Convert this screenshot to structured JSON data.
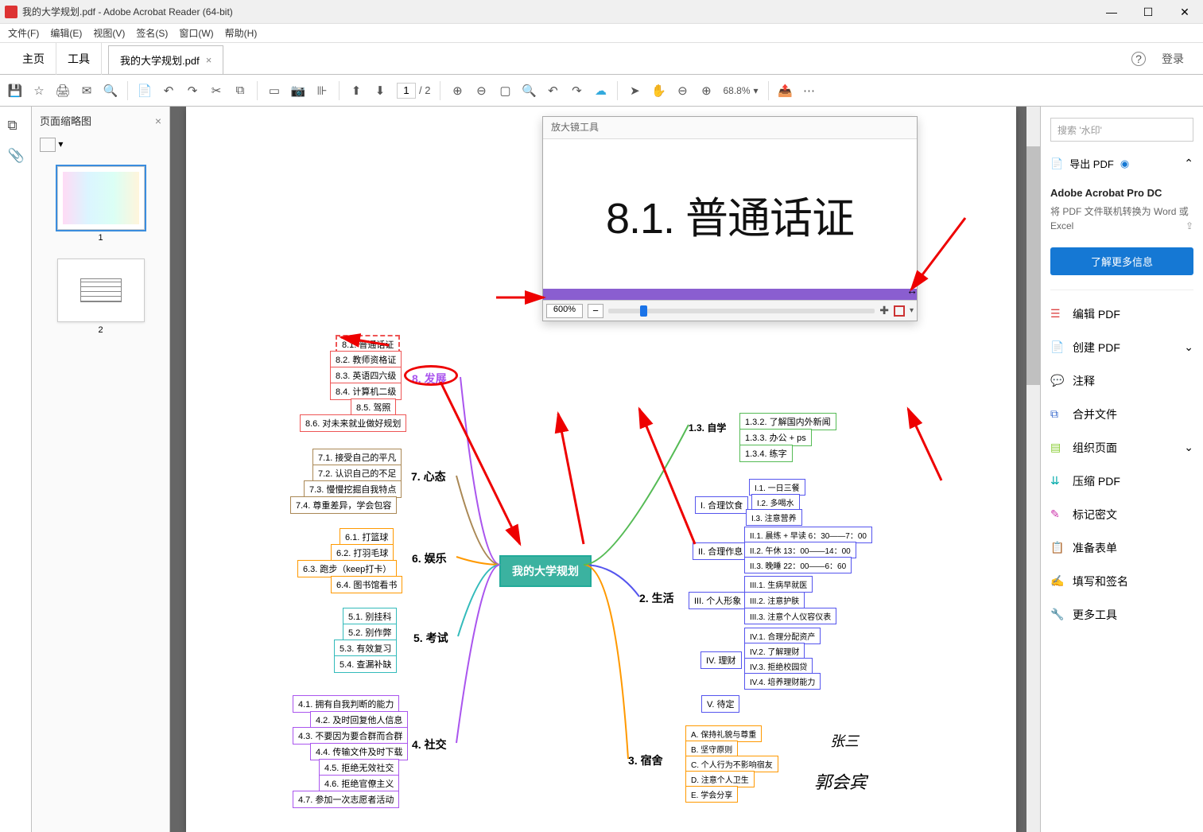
{
  "titlebar": {
    "title": "我的大学规划.pdf - Adobe Acrobat Reader (64-bit)"
  },
  "menu": [
    "文件(F)",
    "编辑(E)",
    "视图(V)",
    "签名(S)",
    "窗口(W)",
    "帮助(H)"
  ],
  "tabbar": {
    "home": "主页",
    "tools": "工具",
    "active": "我的大学规划.pdf",
    "login": "登录"
  },
  "toolbar": {
    "page_current": "1",
    "page_total": "/ 2",
    "zoom": "68.8%"
  },
  "thumbpane": {
    "title": "页面缩略图",
    "labels": [
      "1",
      "2"
    ]
  },
  "magnifier": {
    "title": "放大镜工具",
    "big_text": "8.1. 普通话证",
    "zoom": "600%"
  },
  "mindmap": {
    "center": "我的大学规划",
    "b8": {
      "label": "8. 发展",
      "items": [
        "8.1. 普通话证",
        "8.2. 教师资格证",
        "8.3. 英语四六级",
        "8.4. 计算机二级",
        "8.5. 驾照",
        "8.6. 对未来就业做好规划"
      ]
    },
    "b7": {
      "label": "7. 心态",
      "items": [
        "7.1. 接受自己的平凡",
        "7.2. 认识自己的不足",
        "7.3. 慢慢挖掘自我特点",
        "7.4. 尊重差异，学会包容"
      ]
    },
    "b6": {
      "label": "6. 娱乐",
      "items": [
        "6.1. 打篮球",
        "6.2. 打羽毛球",
        "6.3. 跑步（keep打卡）",
        "6.4. 图书馆看书"
      ]
    },
    "b5": {
      "label": "5. 考试",
      "items": [
        "5.1. 别挂科",
        "5.2. 别作弊",
        "5.3. 有效复习",
        "5.4. 查漏补缺"
      ]
    },
    "b4": {
      "label": "4. 社交",
      "items": [
        "4.1. 拥有自我判断的能力",
        "4.2. 及时回复他人信息",
        "4.3. 不要因为要合群而合群",
        "4.4. 传输文件及时下载",
        "4.5. 拒绝无效社交",
        "4.6. 拒绝官僚主义",
        "4.7. 参加一次志愿者活动"
      ]
    },
    "b1": {
      "label": "1.3. 自学",
      "items": [
        "1.3.2. 了解国内外新闻",
        "1.3.3. 办公 + ps",
        "1.3.4. 练字"
      ]
    },
    "b2": {
      "label": "2. 生活",
      "i": {
        "label": "I. 合理饮食",
        "items": [
          "I.1. 一日三餐",
          "I.2. 多喝水",
          "I.3. 注意营养"
        ]
      },
      "ii": {
        "label": "II. 合理作息",
        "items": [
          "II.1. 晨练 + 早读 6：30——7：00",
          "II.2. 午休 13：00——14：00",
          "II.3. 晚睡 22：00——6：60"
        ]
      },
      "iii": {
        "label": "III. 个人形象",
        "items": [
          "III.1. 生病早就医",
          "III.2. 注意护肤",
          "III.3. 注意个人仪容仪表"
        ]
      },
      "iv": {
        "label": "IV. 理财",
        "items": [
          "IV.1. 合理分配资产",
          "IV.2. 了解理财",
          "IV.3. 拒绝校园贷",
          "IV.4. 培养理财能力"
        ]
      },
      "v": {
        "label": "V. 待定"
      }
    },
    "b3": {
      "label": "3. 宿舍",
      "items": [
        "A. 保持礼貌与尊重",
        "B. 坚守原则",
        "C. 个人行为不影响宿友",
        "D. 注意个人卫生",
        "E. 学会分享"
      ]
    },
    "sig1": "张三",
    "sig2": "郭会宾"
  },
  "rtools": {
    "search_placeholder": "搜索 '水印'",
    "export": "导出 PDF",
    "promo_title": "Adobe Acrobat Pro DC",
    "promo_text": "将 PDF 文件联机转换为 Word 或 Excel",
    "cta": "了解更多信息",
    "tools": [
      "编辑 PDF",
      "创建 PDF",
      "注释",
      "合并文件",
      "组织页面",
      "压缩 PDF",
      "标记密文",
      "准备表单",
      "填写和签名",
      "更多工具"
    ]
  }
}
